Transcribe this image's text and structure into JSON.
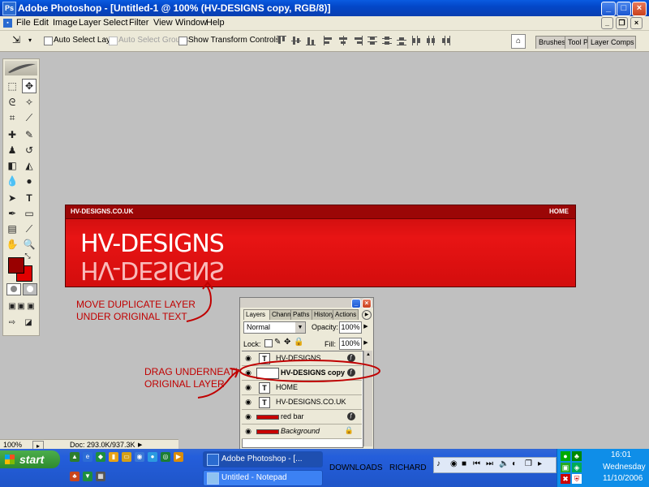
{
  "window": {
    "title": "Adobe Photoshop - [Untitled-1 @ 100% (HV-DESIGNS copy, RGB/8)]",
    "app_icon": "Ps"
  },
  "menu": [
    "File",
    "Edit",
    "Image",
    "Layer",
    "Select",
    "Filter",
    "View",
    "Window",
    "Help"
  ],
  "options": {
    "auto_select_layer": "Auto Select Layer",
    "auto_select_groups": "Auto Select Groups",
    "show_transform_controls": "Show Transform Controls"
  },
  "palette_well": {
    "tabs": [
      "Brushes",
      "Tool Pr",
      "Layer Comps"
    ]
  },
  "canvas": {
    "site_text": "HV-DESIGNS.CO.UK",
    "home_text": "HOME",
    "logo_text": "HV-DESIGNS",
    "logo_flipped": "HV-DESIGNS",
    "colors": {
      "bar": "#d81010",
      "topbar": "#9b0606"
    }
  },
  "annotations": {
    "move_note_1": "MOVE DUPLICATE LAYER",
    "move_note_2": "UNDER ORIGINAL TEXT",
    "drag_note_1": "DRAG UNDERNEATH",
    "drag_note_2": "ORIGINAL LAYER",
    "annotation_color": "#c00000"
  },
  "layers_panel": {
    "tabs": [
      "Layers",
      "Channels",
      "Paths",
      "History",
      "Actions"
    ],
    "blend_mode": "Normal",
    "opacity_label": "Opacity:",
    "opacity_value": "100%",
    "lock_label": "Lock:",
    "fill_label": "Fill:",
    "fill_value": "100%",
    "layers": [
      {
        "name": "HV-DESIGNS",
        "type": "text"
      },
      {
        "name": "HV-DESIGNS copy",
        "type": "effect",
        "selected": true
      },
      {
        "name": "HOME",
        "type": "text"
      },
      {
        "name": "HV-DESIGNS.CO.UK",
        "type": "text"
      },
      {
        "name": "red bar",
        "type": "shape"
      },
      {
        "name": "Background",
        "type": "background"
      }
    ]
  },
  "status": {
    "zoom": "100%",
    "doc": "Doc: 293.0K/937.3K"
  },
  "taskbar": {
    "start": "start",
    "buttons": [
      "Adobe Photoshop - [...",
      "Untitled - Notepad"
    ],
    "labels": [
      "DOWNLOADS",
      "RICHARD"
    ],
    "clock_time": "16:01",
    "clock_day": "Wednesday",
    "clock_date": "11/10/2006"
  }
}
